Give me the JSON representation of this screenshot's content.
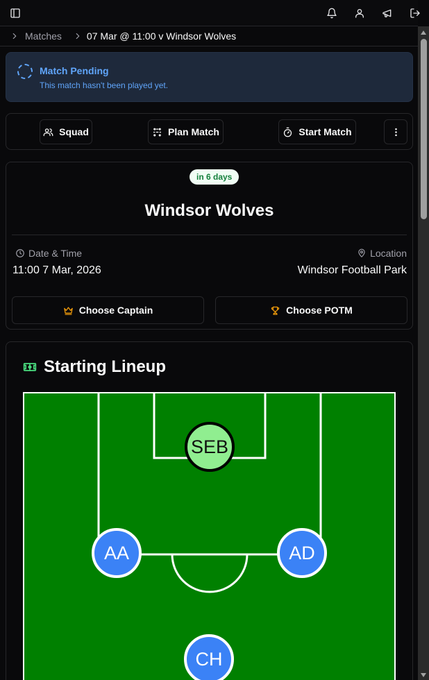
{
  "breadcrumb": {
    "items": [
      "Matches",
      "07 Mar @ 11:00 v Windsor Wolves"
    ]
  },
  "icons": {
    "sidebar": "panel-left-icon",
    "notifications": "bell-icon",
    "account": "user-icon",
    "announcements": "megaphone-icon",
    "logout": "log-out-icon"
  },
  "status": {
    "title": "Match Pending",
    "subtitle": "This match hasn't been played yet."
  },
  "actions": {
    "squad": "Squad",
    "plan": "Plan Match",
    "start": "Start Match"
  },
  "match": {
    "badge": "in 6 days",
    "opponent": "Windsor Wolves",
    "date_label": "Date & Time",
    "date_value": "11:00 7 Mar, 2026",
    "location_label": "Location",
    "location_value": "Windsor Football Park",
    "captain_button": "Choose Captain",
    "potm_button": "Choose POTM"
  },
  "lineup": {
    "title": "Starting Lineup",
    "players": [
      {
        "initials": "SEB",
        "role": "goalkeeper"
      },
      {
        "initials": "AA",
        "role": "defender"
      },
      {
        "initials": "AD",
        "role": "defender"
      },
      {
        "initials": "CH",
        "role": "midfielder"
      }
    ]
  },
  "colors": {
    "pitch": "#008000",
    "goalkeeper": "#90ee90",
    "outfield": "#3b82f6",
    "pending_text": "#60a5fa",
    "pending_bg": "#1e293b",
    "badge_text": "#15803d",
    "accent_gold": "#f59e0b"
  }
}
